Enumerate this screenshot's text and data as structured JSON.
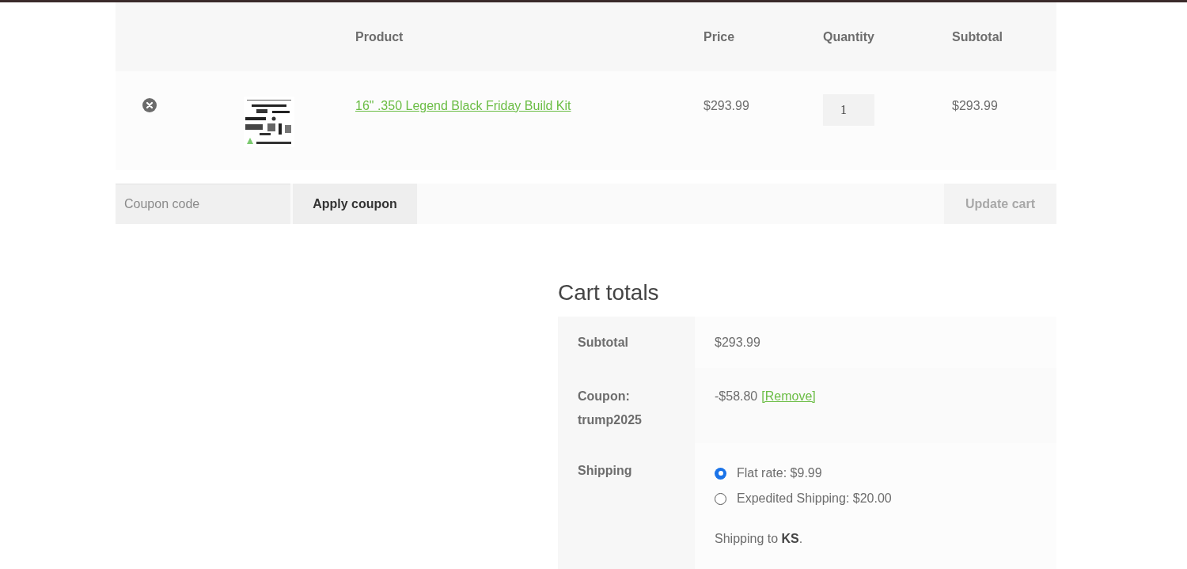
{
  "cart_table": {
    "columns": [
      "Product",
      "Price",
      "Quantity",
      "Subtotal"
    ],
    "rows": [
      {
        "product": "16\" .350 Legend Black Friday Build Kit",
        "price": "$293.99",
        "quantity": "1",
        "subtotal": "$293.99"
      }
    ]
  },
  "coupon": {
    "placeholder": "Coupon code",
    "apply_button": "Apply coupon"
  },
  "update_button": {
    "label": "Update cart",
    "disabled": true
  },
  "cart_totals": {
    "title": "Cart totals",
    "subtotal": {
      "label": "Subtotal",
      "value": "$293.99"
    },
    "coupon": {
      "label": "Coupon: trump2025",
      "value": "-$58.80",
      "remove_link": "[Remove]"
    },
    "shipping": {
      "label": "Shipping",
      "options": [
        {
          "label": "Flat rate: $9.99",
          "selected": true
        },
        {
          "label": "Expedited Shipping: $20.00",
          "selected": false
        }
      ],
      "destination": "Shipping to **KS**."
    }
  }
}
